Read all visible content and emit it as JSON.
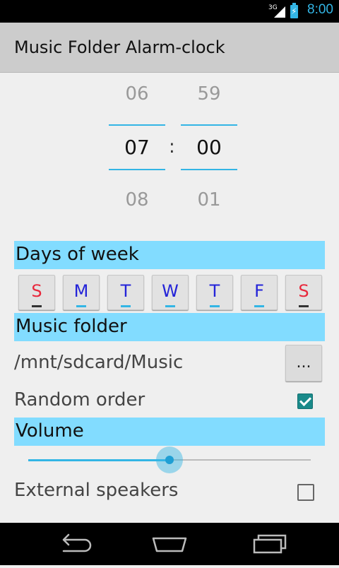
{
  "status_bar": {
    "network": "3G",
    "time": "8:00",
    "icons": [
      "signal-icon",
      "battery-charging-icon"
    ]
  },
  "app": {
    "title": "Music Folder Alarm-clock"
  },
  "time_picker": {
    "hours": {
      "prev": "06",
      "current": "07",
      "next": "08"
    },
    "minutes": {
      "prev": "59",
      "current": "00",
      "next": "01"
    },
    "separator": ":"
  },
  "days": {
    "header": "Days of week",
    "items": [
      {
        "label": "S",
        "color": "#e8283c",
        "indicator": "#333333"
      },
      {
        "label": "M",
        "color": "#2323d8",
        "indicator": "#33b5e5"
      },
      {
        "label": "T",
        "color": "#2323d8",
        "indicator": "#33b5e5"
      },
      {
        "label": "W",
        "color": "#2323d8",
        "indicator": "#33b5e5"
      },
      {
        "label": "T",
        "color": "#2323d8",
        "indicator": "#33b5e5"
      },
      {
        "label": "F",
        "color": "#2323d8",
        "indicator": "#33b5e5"
      },
      {
        "label": "S",
        "color": "#e8283c",
        "indicator": "#333333"
      }
    ]
  },
  "music_folder": {
    "header": "Music folder",
    "path": "/mnt/sdcard/Music",
    "browse_label": "..."
  },
  "random_order": {
    "label": "Random order",
    "checked": true
  },
  "volume": {
    "header": "Volume",
    "level": 0.5
  },
  "external_speakers": {
    "label": "External speakers",
    "checked": false
  },
  "navigation": {
    "buttons": [
      "back-icon",
      "home-icon",
      "recent-apps-icon"
    ]
  },
  "colors": {
    "accent": "#33b5e5",
    "section_bg": "#82dcff",
    "checkbox_on": "#1a8a8a"
  }
}
